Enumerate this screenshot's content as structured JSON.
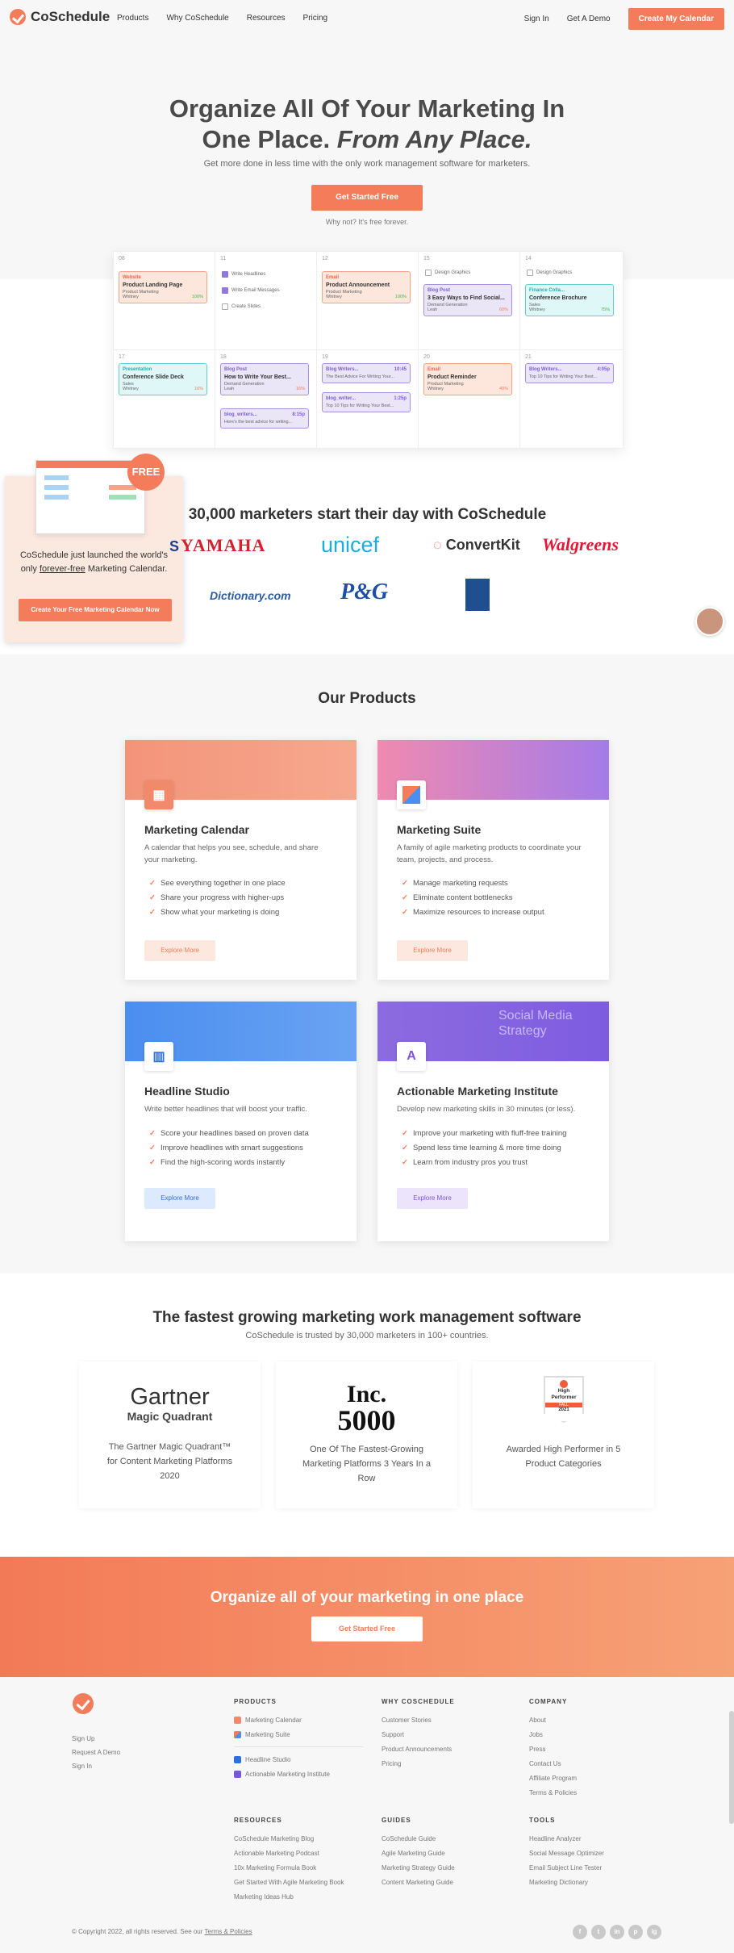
{
  "nav": {
    "brand": "CoSchedule",
    "links": [
      "Products",
      "Why CoSchedule",
      "Resources",
      "Pricing"
    ],
    "sign_in": "Sign In",
    "demo": "Get A Demo",
    "cta": "Create My Calendar"
  },
  "hero": {
    "title_line1": "Organize All Of Your Marketing In",
    "title_line2_plain": "One Place.",
    "title_line2_em": "From Any Place.",
    "subtitle": "Get more done in less time with the only work management software for marketers.",
    "cta": "Get Started Free",
    "note": "Why not? It's free forever."
  },
  "calendar": {
    "week1": [
      {
        "day": "08",
        "tag": "Website",
        "badge": "Published",
        "title": "Product Landing Page",
        "meta": "Product Marketing",
        "owner": "Whitney",
        "progress": "100%"
      },
      {
        "day": "11",
        "tasks": [
          "Write Headlines",
          "Write Email Messages",
          "Create Slides"
        ]
      },
      {
        "day": "12",
        "tag": "Email",
        "badge": "Published",
        "title": "Product Announcement",
        "meta": "Product Marketing",
        "owner": "Whitney",
        "progress": "100%"
      },
      {
        "day": "15",
        "task": "Design Graphics",
        "tag": "Blog Post",
        "badge": "Pending Review",
        "title": "3 Easy Ways to Find Social...",
        "meta": "Demand Generation",
        "owner": "Leah",
        "progress": "60%"
      },
      {
        "day": "14",
        "task": "Design Graphics",
        "tag": "Finance Colla...",
        "badge": "Draft",
        "title": "Conference Brochure",
        "meta": "Sales",
        "owner": "Whitney",
        "progress": "75%",
        "chips": [
          "Q3 Conference",
          "Printed"
        ]
      }
    ],
    "week2": [
      {
        "day": "17",
        "tag": "Presentation",
        "badge": "Draft",
        "title": "Conference Slide Deck",
        "meta": "Sales",
        "owner": "Whitney",
        "progress": "16%",
        "chips": [
          "Q3 Conference",
          "Worldwide"
        ]
      },
      {
        "day": "18",
        "tag": "Blog Post",
        "badge": "Draft",
        "title": "How to Write Your Best...",
        "meta": "Demand Generation",
        "owner": "Leah",
        "progress": "16%",
        "social_tag": "blog_writers...",
        "social_time": "8:15p",
        "social_text": "Here's the best advice for writing..."
      },
      {
        "day": "19",
        "social": [
          {
            "tag": "Blog Writers...",
            "time": "10:45",
            "text": "The Best Advice For Writing Your..."
          },
          {
            "tag": "blog_writer...",
            "time": "1:25p",
            "text": "Top 10 Tips for Writing Your Best..."
          }
        ]
      },
      {
        "day": "20",
        "tag": "Email",
        "badge": "Draft",
        "title": "Product Reminder",
        "meta": "Product Marketing",
        "owner": "Whitney",
        "progress": "40%"
      },
      {
        "day": "21",
        "social_tag": "Blog Writers...",
        "social_time": "4:05p",
        "social_text": "Top 10 Tips for Writing Your Best..."
      }
    ]
  },
  "popup": {
    "badge": "FREE",
    "text_before": "CoSchedule just launched the world's only",
    "text_link": "forever-free",
    "text_after": "Marketing Calendar.",
    "cta": "Create Your Free Marketing Calendar Now"
  },
  "trust": {
    "title": "30,000 marketers start their day with CoSchedule",
    "logos": [
      "YAMAHA",
      "unicef",
      "ConvertKit",
      "Walgreens",
      "Dictionary.com",
      "P&G"
    ]
  },
  "products": {
    "title": "Our Products",
    "items": [
      {
        "name": "Marketing Calendar",
        "desc": "A calendar that helps you see, schedule, and share your marketing.",
        "points": [
          "See everything together in one place",
          "Share your progress with higher-ups",
          "Show what your marketing is doing"
        ],
        "cta": "Explore More"
      },
      {
        "name": "Marketing Suite",
        "desc": "A family of agile marketing products to coordinate your team, projects, and process.",
        "points": [
          "Manage marketing requests",
          "Eliminate content bottlenecks",
          "Maximize resources to increase output"
        ],
        "cta": "Explore More"
      },
      {
        "name": "Headline Studio",
        "desc": "Write better headlines that will boost your traffic.",
        "points": [
          "Score your headlines based on proven data",
          "Improve headlines with smart suggestions",
          "Find the high-scoring words instantly"
        ],
        "cta": "Explore More"
      },
      {
        "name": "Actionable Marketing Institute",
        "desc": "Develop new marketing skills in 30 minutes (or less).",
        "points": [
          "Improve your marketing with fluff-free training",
          "Spend less time learning & more time doing",
          "Learn from industry pros you trust"
        ],
        "cta": "Explore More",
        "banner_text": "Social Media Strategy"
      }
    ]
  },
  "awards": {
    "title": "The fastest growing marketing work management software",
    "subtitle": "CoSchedule is trusted by 30,000 marketers in 100+ countries.",
    "items": [
      {
        "logo1": "Gartner",
        "logo2": "Magic Quadrant",
        "text": "The Gartner Magic Quadrant™ for Content Marketing Platforms 2020"
      },
      {
        "logo1": "Inc.",
        "logo2": "5000",
        "text": "One Of The Fastest-Growing Marketing Platforms 3 Years In a Row"
      },
      {
        "logo1": "High Performer",
        "logo2": "2021",
        "logo_small": "FALL",
        "text": "Awarded High Performer in 5 Product Categories"
      }
    ]
  },
  "cta_band": {
    "title": "Organize all of your marketing in one place",
    "cta": "Get Started Free"
  },
  "footer": {
    "left_links": [
      "Sign Up",
      "Request A Demo",
      "Sign In"
    ],
    "products": {
      "heading": "PRODUCTS",
      "items": [
        "Marketing Calendar",
        "Marketing Suite",
        "Headline Studio",
        "Actionable Marketing Institute"
      ]
    },
    "why": {
      "heading": "WHY COSCHEDULE",
      "items": [
        "Customer Stories",
        "Support",
        "Product Announcements",
        "Pricing"
      ]
    },
    "company": {
      "heading": "COMPANY",
      "items": [
        "About",
        "Jobs",
        "Press",
        "Contact Us",
        "Affiliate Program",
        "Terms & Policies"
      ]
    },
    "resources": {
      "heading": "RESOURCES",
      "items": [
        "CoSchedule Marketing Blog",
        "Actionable Marketing Podcast",
        "10x Marketing Formula Book",
        "Get Started With Agile Marketing Book",
        "Marketing Ideas Hub"
      ]
    },
    "guides": {
      "heading": "GUIDES",
      "items": [
        "CoSchedule Guide",
        "Agile Marketing Guide",
        "Marketing Strategy Guide",
        "Content Marketing Guide"
      ]
    },
    "tools": {
      "heading": "TOOLS",
      "items": [
        "Headline Analyzer",
        "Social Message Optimizer",
        "Email Subject Line Tester",
        "Marketing Dictionary"
      ]
    },
    "copyright": "© Copyright 2022, all rights reserved. See our",
    "copyright_link": "Terms & Policies",
    "social": [
      "f",
      "t",
      "in",
      "p",
      "ig"
    ]
  }
}
